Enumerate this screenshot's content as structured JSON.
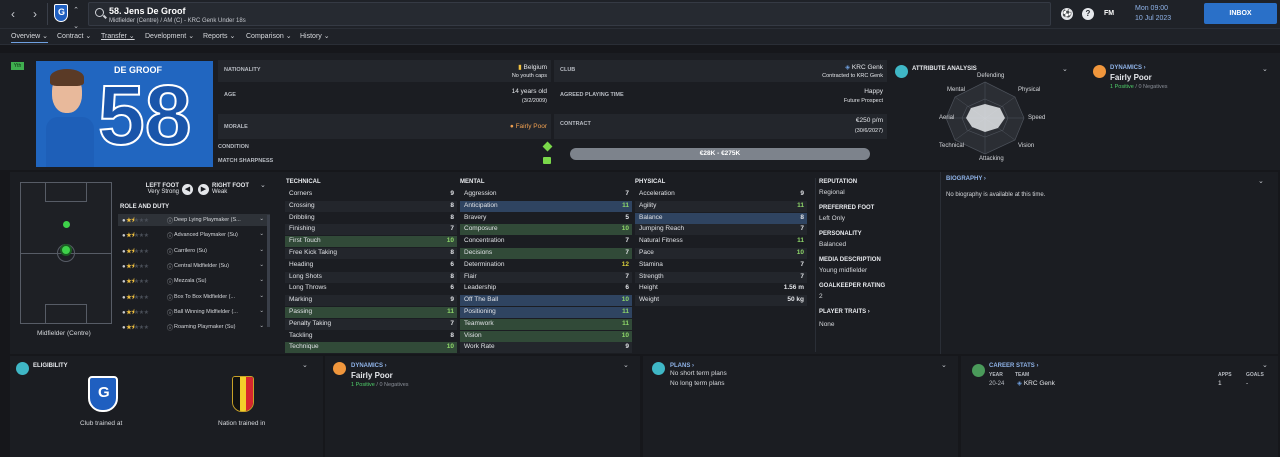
{
  "topbar": {
    "player_title": "58. Jens De Groof",
    "player_subtitle": "Midfielder (Centre) / AM (C) - KRC Genk Under 18s",
    "fm_label": "FM",
    "date_line1": "Mon 09:00",
    "date_line2": "10 Jul 2023",
    "inbox_label": "INBOX"
  },
  "tabs": [
    {
      "label": "Overview"
    },
    {
      "label": "Contract"
    },
    {
      "label": "Transfer"
    },
    {
      "label": "Development"
    },
    {
      "label": "Reports"
    },
    {
      "label": "Comparison"
    },
    {
      "label": "History"
    }
  ],
  "profile": {
    "shirt_name": "DE GROOF",
    "shirt_number": "58",
    "badge": "Yth",
    "nationality_label": "NATIONALITY",
    "nationality": "Belgium",
    "youth_caps": "No youth caps",
    "age_label": "AGE",
    "age": "14 years old",
    "dob": "(3/2/2009)",
    "morale_label": "MORALE",
    "morale": "Fairly Poor",
    "condition_label": "CONDITION",
    "sharpness_label": "MATCH SHARPNESS",
    "club_label": "CLUB",
    "club": "KRC Genk",
    "club_status": "Contracted to KRC Genk",
    "playing_time_label": "AGREED PLAYING TIME",
    "playing_time_happy": "Happy",
    "playing_time": "Future Prospect",
    "contract_label": "CONTRACT",
    "wage": "€250 p/m",
    "contract_end": "(30/6/2027)",
    "value": "€28K - €275K"
  },
  "attribute_analysis": {
    "header": "ATTRIBUTE ANALYSIS",
    "labels": [
      "Defending",
      "Physical",
      "Speed",
      "Vision",
      "Attacking",
      "Technical",
      "Aerial",
      "Mental"
    ]
  },
  "dynamics_top": {
    "header": "DYNAMICS",
    "rating": "Fairly Poor",
    "positive": "1 Positive",
    "separator": "/",
    "negative": "0 Negatives"
  },
  "feet": {
    "left_label": "LEFT FOOT",
    "left_value": "Very Strong",
    "right_label": "RIGHT FOOT",
    "right_value": "Weak"
  },
  "role_duty_header": "ROLE AND DUTY",
  "pitch_position": "Midfielder (Centre)",
  "roles": [
    {
      "name": "Deep Lying Playmaker (S...",
      "stars": 1.5
    },
    {
      "name": "Advanced Playmaker (Su)",
      "stars": 1.5
    },
    {
      "name": "Carrilero (Su)",
      "stars": 1.5
    },
    {
      "name": "Central Midfielder (Su)",
      "stars": 1.5
    },
    {
      "name": "Mezzala (Su)",
      "stars": 1.5
    },
    {
      "name": "Box To Box Midfielder (...",
      "stars": 1.5
    },
    {
      "name": "Ball Winning Midfielder (...",
      "stars": 1.5
    },
    {
      "name": "Roaming Playmaker (Su)",
      "stars": 1.5
    }
  ],
  "technical": {
    "header": "TECHNICAL",
    "rows": [
      {
        "name": "Corners",
        "value": "9"
      },
      {
        "name": "Crossing",
        "value": "8"
      },
      {
        "name": "Dribbling",
        "value": "8"
      },
      {
        "name": "Finishing",
        "value": "7"
      },
      {
        "name": "First Touch",
        "value": "10"
      },
      {
        "name": "Free Kick Taking",
        "value": "8"
      },
      {
        "name": "Heading",
        "value": "6"
      },
      {
        "name": "Long Shots",
        "value": "8"
      },
      {
        "name": "Long Throws",
        "value": "6"
      },
      {
        "name": "Marking",
        "value": "9"
      },
      {
        "name": "Passing",
        "value": "11"
      },
      {
        "name": "Penalty Taking",
        "value": "7"
      },
      {
        "name": "Tackling",
        "value": "8"
      },
      {
        "name": "Technique",
        "value": "10"
      }
    ]
  },
  "mental": {
    "header": "MENTAL",
    "rows": [
      {
        "name": "Aggression",
        "value": "7"
      },
      {
        "name": "Anticipation",
        "value": "11"
      },
      {
        "name": "Bravery",
        "value": "5"
      },
      {
        "name": "Composure",
        "value": "10"
      },
      {
        "name": "Concentration",
        "value": "7"
      },
      {
        "name": "Decisions",
        "value": "7"
      },
      {
        "name": "Determination",
        "value": "12"
      },
      {
        "name": "Flair",
        "value": "7"
      },
      {
        "name": "Leadership",
        "value": "6"
      },
      {
        "name": "Off The Ball",
        "value": "10"
      },
      {
        "name": "Positioning",
        "value": "11"
      },
      {
        "name": "Teamwork",
        "value": "11"
      },
      {
        "name": "Vision",
        "value": "10"
      },
      {
        "name": "Work Rate",
        "value": "9"
      }
    ]
  },
  "physical": {
    "header": "PHYSICAL",
    "rows": [
      {
        "name": "Acceleration",
        "value": "9"
      },
      {
        "name": "Agility",
        "value": "11"
      },
      {
        "name": "Balance",
        "value": "8"
      },
      {
        "name": "Jumping Reach",
        "value": "7"
      },
      {
        "name": "Natural Fitness",
        "value": "11"
      },
      {
        "name": "Pace",
        "value": "10"
      },
      {
        "name": "Stamina",
        "value": "7"
      },
      {
        "name": "Strength",
        "value": "7"
      },
      {
        "name": "Height",
        "value": "1.56 m"
      },
      {
        "name": "Weight",
        "value": "50 kg"
      }
    ]
  },
  "info": {
    "reputation_label": "REPUTATION",
    "reputation": "Regional",
    "preferred_foot_label": "PREFERRED FOOT",
    "preferred_foot": "Left Only",
    "personality_label": "PERSONALITY",
    "personality": "Balanced",
    "media_label": "MEDIA DESCRIPTION",
    "media": "Young midfielder",
    "gk_label": "GOALKEEPER RATING",
    "gk": "2",
    "traits_label": "PLAYER TRAITS",
    "traits": "None"
  },
  "biography": {
    "header": "BIOGRAPHY",
    "text": "No biography is available at this time."
  },
  "eligibility": {
    "header": "ELIGIBILITY",
    "club_caption": "Club trained at",
    "nation_caption": "Nation trained in"
  },
  "dynamics_bottom": {
    "header": "DYNAMICS",
    "rating": "Fairly Poor",
    "positive": "1 Positive",
    "separator": "/",
    "negative": "0 Negatives"
  },
  "plans": {
    "header": "PLANS",
    "short": "No short term plans",
    "long": "No long term plans"
  },
  "career": {
    "header": "CAREER STATS",
    "year_h": "YEAR",
    "team_h": "TEAM",
    "apps_h": "APPS",
    "goals_h": "GOALS",
    "year": "20-24",
    "team": "KRC Genk",
    "apps": "1",
    "goals": "-"
  },
  "colors": {
    "accent": "#2a70c8",
    "green": "#4fcf6a",
    "orange": "#f0963c",
    "teal": "#3fb7c6"
  }
}
